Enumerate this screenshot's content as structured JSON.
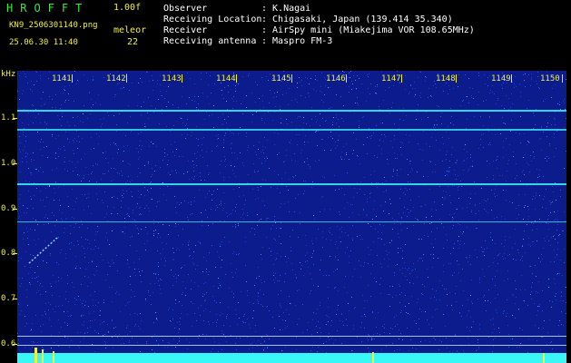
{
  "header": {
    "app_title": "HROFFT",
    "version": "1.00f",
    "filename": "KN9_2506301140.png",
    "row_label": "meleor",
    "timestamp": "25.06.30 11:40",
    "frames": "22",
    "meta": [
      {
        "label": "Observer",
        "value": ": K.Nagai"
      },
      {
        "label": "Receiving Location",
        "value": ": Chigasaki, Japan (139.414 35.340)"
      },
      {
        "label": "Receiver",
        "value": ": AirSpy mini (Miakejima VOR 108.65MHz)"
      },
      {
        "label": "Receiving antenna",
        "value": ": Maspro FM-3"
      }
    ]
  },
  "axes": {
    "y_unit": "kHz",
    "y_ticks": [
      "1.1",
      "1.0",
      "0.9",
      "0.8",
      "0.7",
      "0.6"
    ],
    "x_ticks": [
      "1141",
      "1142",
      "1143",
      "1144",
      "1145",
      "1146",
      "1147",
      "1148",
      "1149",
      "1150"
    ]
  },
  "colors": {
    "background": "#0c1c8c",
    "signal": "#39f7f7",
    "label": "#f2ef3a",
    "title": "#3ce83c"
  }
}
